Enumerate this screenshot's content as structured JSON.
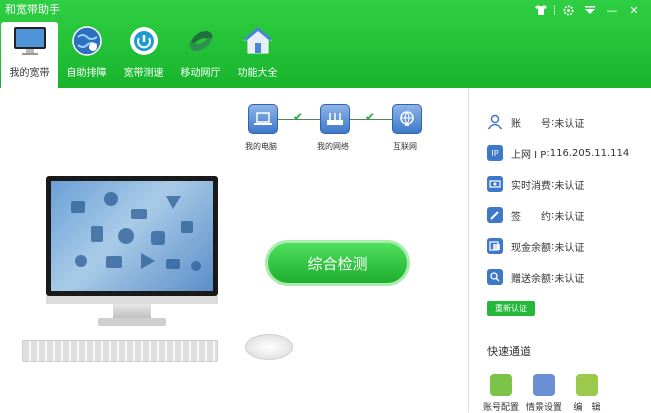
{
  "app": {
    "title": "和宽带助手"
  },
  "window_controls": {
    "shirt_icon": "shirt-icon",
    "settings_icon": "gear-icon",
    "menu_icon": "menu-icon",
    "minimize": "—",
    "close": "✕"
  },
  "nav": [
    {
      "label": "我的宽带",
      "icon": "monitor-icon",
      "active": true
    },
    {
      "label": "自助排障",
      "icon": "globe-icon",
      "active": false
    },
    {
      "label": "宽带测速",
      "icon": "speed-icon",
      "active": false
    },
    {
      "label": "移动网厅",
      "icon": "china-mobile-icon",
      "active": false
    },
    {
      "label": "功能大全",
      "icon": "house-icon",
      "active": false
    }
  ],
  "network": {
    "nodes": [
      {
        "label": "我的电脑",
        "icon": "laptop-icon"
      },
      {
        "label": "我的网络",
        "icon": "router-icon"
      },
      {
        "label": "互联网",
        "icon": "globe-icon"
      }
    ],
    "checks": [
      "✔",
      "✔"
    ]
  },
  "main": {
    "check_button": "综合检测"
  },
  "account": {
    "rows": [
      {
        "label": "账　　号",
        "sep": ":",
        "value": "未认证",
        "icon": "user-icon"
      },
      {
        "label": "上网 I P",
        "sep": ":",
        "value": "116.205.11.114",
        "icon": "ip-icon"
      },
      {
        "label": "实时消费",
        "sep": ":",
        "value": "未认证",
        "icon": "cash-icon"
      },
      {
        "label": "签　　约",
        "sep": ":",
        "value": "未认证",
        "icon": "pen-icon"
      },
      {
        "label": "现金余额",
        "sep": ":",
        "value": "未认证",
        "icon": "wallet-icon"
      },
      {
        "label": "赠送余额",
        "sep": ":",
        "value": "未认证",
        "icon": "gift-icon"
      }
    ],
    "reauth_button": "重新认证"
  },
  "quick": {
    "title": "快速通道",
    "items": [
      {
        "label": "账号配置",
        "icon": "account-config-icon"
      },
      {
        "label": "情景设置",
        "icon": "scene-settings-icon"
      },
      {
        "label": "编　辑",
        "icon": "edit-icon"
      }
    ]
  },
  "colors": {
    "header_green": "#1fbb33",
    "accent_blue": "#3d78c9",
    "button_green": "#24b73a"
  }
}
